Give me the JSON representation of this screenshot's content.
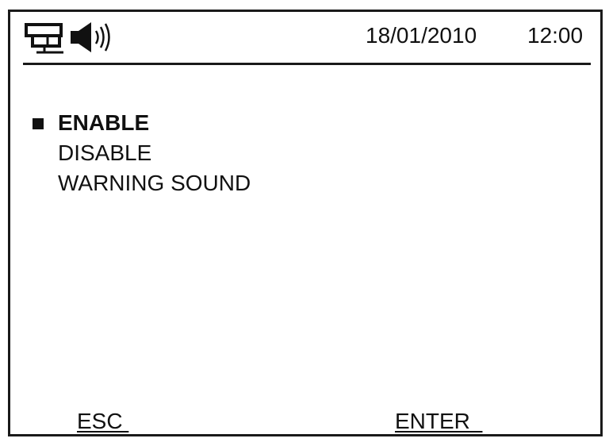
{
  "header": {
    "icons": [
      "network-icon",
      "speaker-icon"
    ],
    "date": "18/01/2010",
    "time": "12:00"
  },
  "menu": {
    "items": [
      {
        "label": "ENABLE",
        "selected": true
      },
      {
        "label": "DISABLE",
        "selected": false
      },
      {
        "label": "WARNING SOUND",
        "selected": false
      }
    ]
  },
  "softkeys": {
    "esc": "ESC ",
    "enter": "ENTER  "
  }
}
